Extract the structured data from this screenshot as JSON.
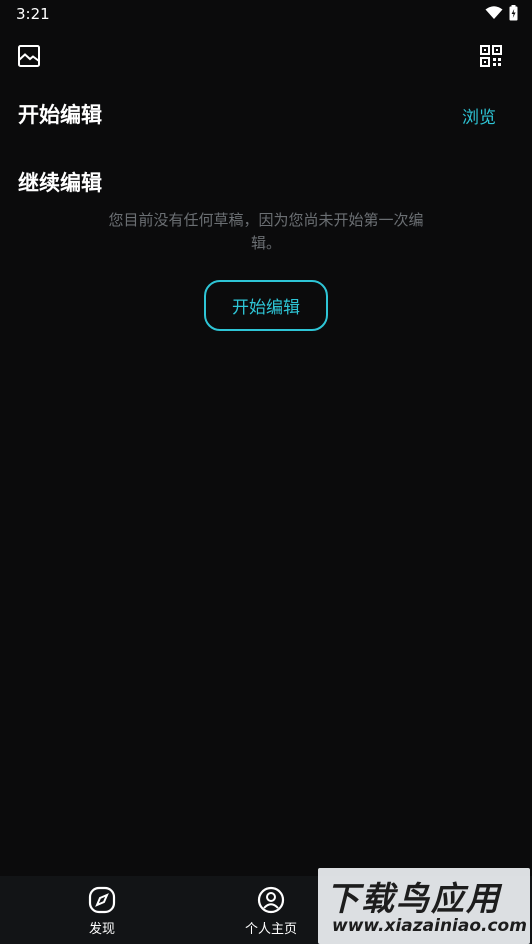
{
  "status_bar": {
    "time": "3:21"
  },
  "header": {
    "gallery_icon": "image-icon",
    "qr_icon": "qr-code-icon"
  },
  "sections": {
    "start_title": "开始编辑",
    "browse_label": "浏览",
    "continue_title": "继续编辑"
  },
  "empty_state": {
    "message": "您目前没有任何草稿，因为您尚未开始第一次编辑。",
    "button_label": "开始编辑"
  },
  "bottom_nav": {
    "items": [
      {
        "label": "发现",
        "icon": "compass-icon"
      },
      {
        "label": "个人主页",
        "icon": "profile-icon"
      }
    ]
  },
  "watermark": {
    "main": "下载鸟应用",
    "sub": "www.xiazainiao.com"
  },
  "colors": {
    "accent": "#2ec5d6",
    "background": "#0b0b0c",
    "muted_text": "#6b6f73",
    "nav_bg": "#121416"
  }
}
